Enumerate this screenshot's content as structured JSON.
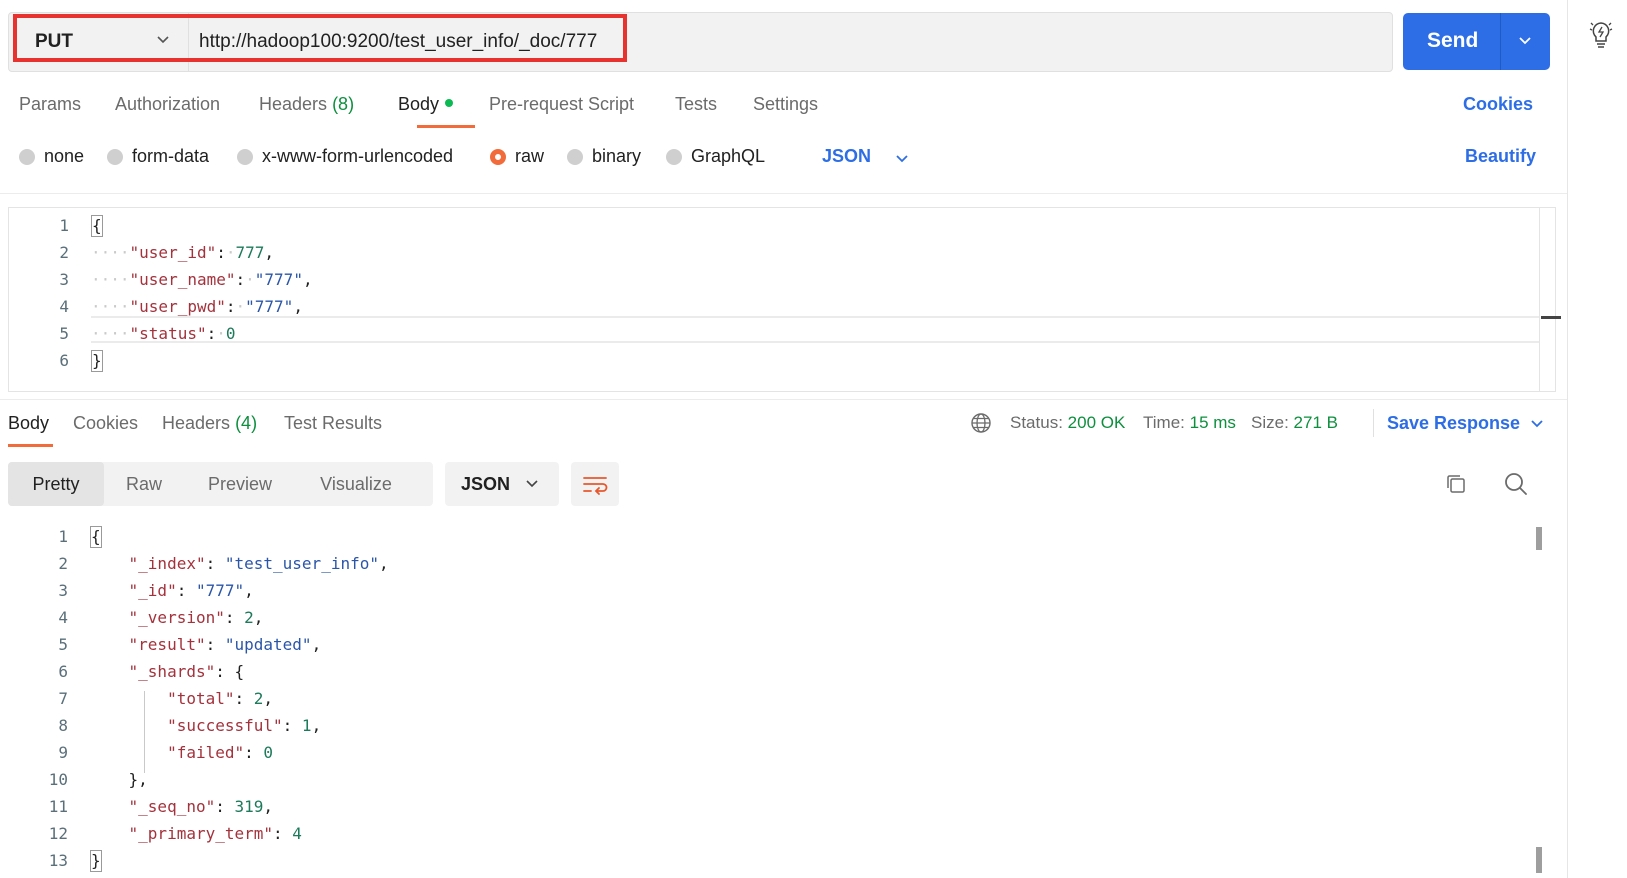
{
  "request": {
    "method": "PUT",
    "url": "http://hadoop100:9200/test_user_info/_doc/777",
    "send_label": "Send"
  },
  "request_tabs": {
    "params": "Params",
    "authorization": "Authorization",
    "headers": "Headers",
    "headers_count": "(8)",
    "body": "Body",
    "pre_request": "Pre-request Script",
    "tests": "Tests",
    "settings": "Settings",
    "cookies": "Cookies"
  },
  "body_types": {
    "none": "none",
    "form_data": "form-data",
    "urlencoded": "x-www-form-urlencoded",
    "raw": "raw",
    "binary": "binary",
    "graphql": "GraphQL",
    "language": "JSON",
    "beautify": "Beautify",
    "selected": "raw"
  },
  "request_body": {
    "line_numbers": [
      "1",
      "2",
      "3",
      "4",
      "5",
      "6"
    ],
    "open": "{",
    "close": "}",
    "fields": [
      {
        "key": "\"user_id\"",
        "value": "777",
        "comma": ","
      },
      {
        "key": "\"user_name\"",
        "value": "\"777\"",
        "comma": ","
      },
      {
        "key": "\"user_pwd\"",
        "value": "\"777\"",
        "comma": ","
      },
      {
        "key": "\"status\"",
        "value": "0",
        "comma": ""
      }
    ]
  },
  "response_tabs": {
    "body": "Body",
    "cookies": "Cookies",
    "headers": "Headers",
    "headers_count": "(4)",
    "test_results": "Test Results"
  },
  "response_meta": {
    "status_label": "Status:",
    "status_value": "200 OK",
    "time_label": "Time:",
    "time_value": "15 ms",
    "size_label": "Size:",
    "size_value": "271 B",
    "save_response": "Save Response"
  },
  "response_view": {
    "modes": [
      "Pretty",
      "Raw",
      "Preview",
      "Visualize"
    ],
    "active": "Pretty",
    "format": "JSON"
  },
  "response_body": {
    "line_numbers": [
      "1",
      "2",
      "3",
      "4",
      "5",
      "6",
      "7",
      "8",
      "9",
      "10",
      "11",
      "12",
      "13"
    ],
    "index_key": "\"_index\"",
    "index_val": "\"test_user_info\"",
    "id_key": "\"_id\"",
    "id_val": "\"777\"",
    "version_key": "\"_version\"",
    "version_val": "2",
    "result_key": "\"result\"",
    "result_val": "\"updated\"",
    "shards_key": "\"_shards\"",
    "total_key": "\"total\"",
    "total_val": "2",
    "successful_key": "\"successful\"",
    "successful_val": "1",
    "failed_key": "\"failed\"",
    "failed_val": "0",
    "seq_key": "\"_seq_no\"",
    "seq_val": "319",
    "term_key": "\"_primary_term\"",
    "term_val": "4"
  },
  "colors": {
    "accent": "#2d6ee6",
    "tab_underline": "#f26b3a",
    "highlight_box": "#e8322f",
    "status_ok": "#0d8f3e"
  }
}
